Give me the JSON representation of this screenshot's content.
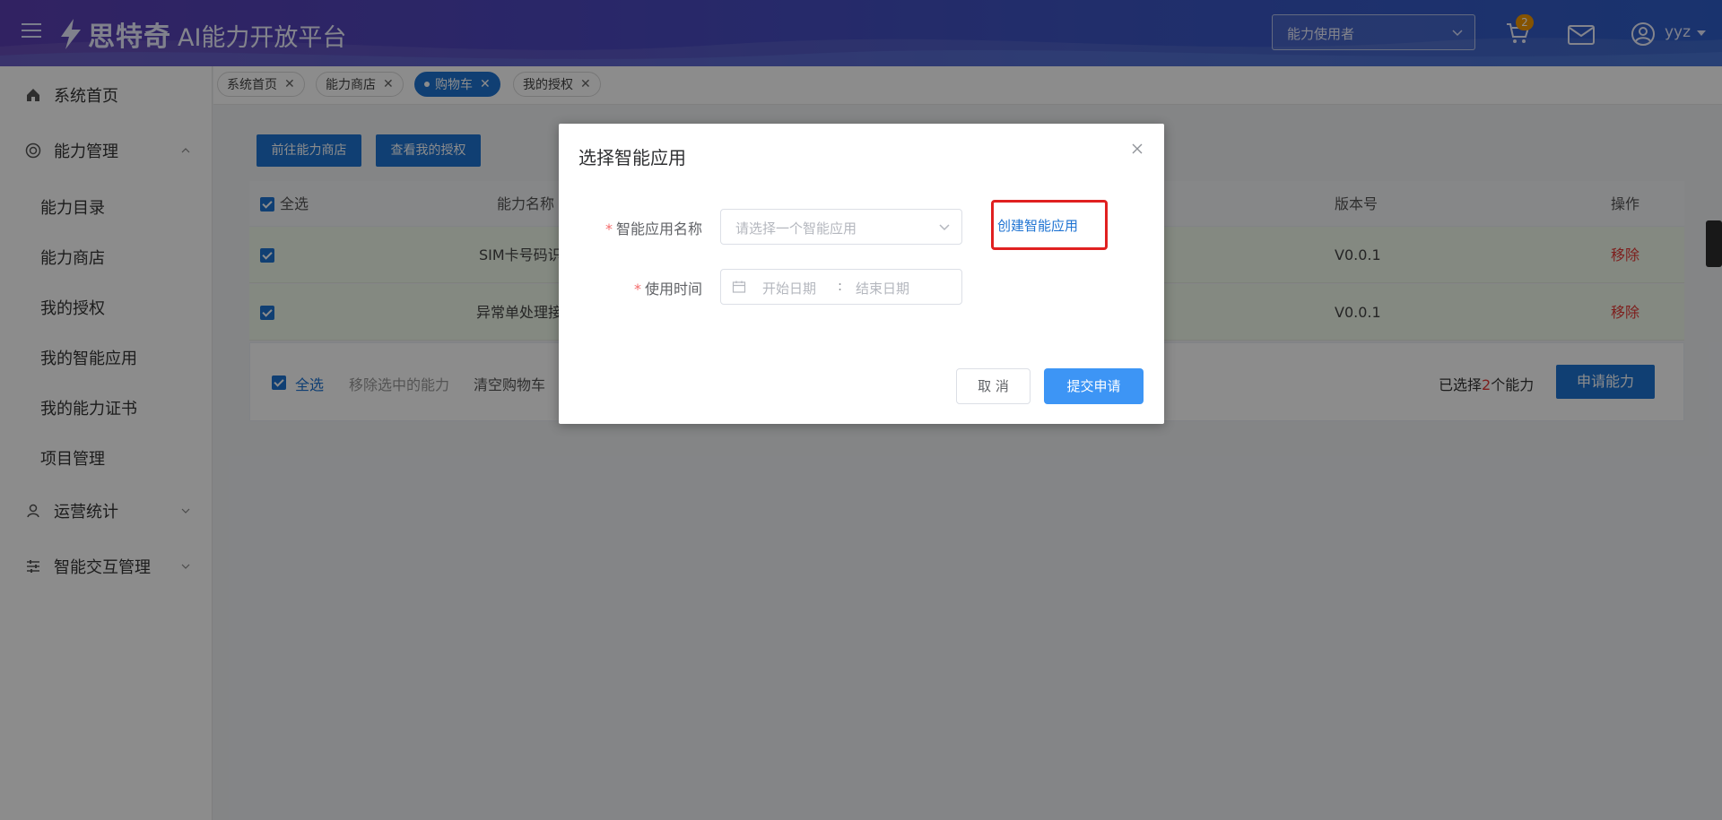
{
  "header": {
    "logo_text": "思特奇",
    "platform_title": "AI能力开放平台",
    "role_select": "能力使用者",
    "cart_count": "2",
    "username": "yyz"
  },
  "sidebar": {
    "home": "系统首页",
    "ability_mgmt": "能力管理",
    "sub_items": [
      "能力目录",
      "能力商店",
      "我的授权",
      "我的智能应用",
      "我的能力证书",
      "项目管理"
    ],
    "ops_stats": "运营统计",
    "smart_interaction": "智能交互管理"
  },
  "tabs": [
    {
      "label": "系统首页"
    },
    {
      "label": "能力商店"
    },
    {
      "label": "购物车"
    },
    {
      "label": "我的授权"
    }
  ],
  "toolbar": {
    "go_store": "前往能力商店",
    "view_auth": "查看我的授权"
  },
  "table": {
    "select_all": "全选",
    "col_name": "能力名称",
    "col_version": "版本号",
    "col_action": "操作",
    "rows": [
      {
        "name": "SIM卡号码识",
        "version": "V0.0.1",
        "action": "移除"
      },
      {
        "name": "异常单处理接",
        "version": "V0.0.1",
        "action": "移除"
      }
    ]
  },
  "footer": {
    "select_all": "全选",
    "remove_selected": "移除选中的能力",
    "clear_cart": "清空购物车",
    "selected_prefix": "已选择",
    "selected_count": "2",
    "selected_suffix": "个能力",
    "apply": "申请能力"
  },
  "modal": {
    "title": "选择智能应用",
    "app_label": "智能应用名称",
    "app_placeholder": "请选择一个智能应用",
    "create_link": "创建智能应用",
    "time_label": "使用时间",
    "start_placeholder": "开始日期",
    "separator": ":",
    "end_placeholder": "结束日期",
    "cancel": "取 消",
    "submit": "提交申请"
  }
}
